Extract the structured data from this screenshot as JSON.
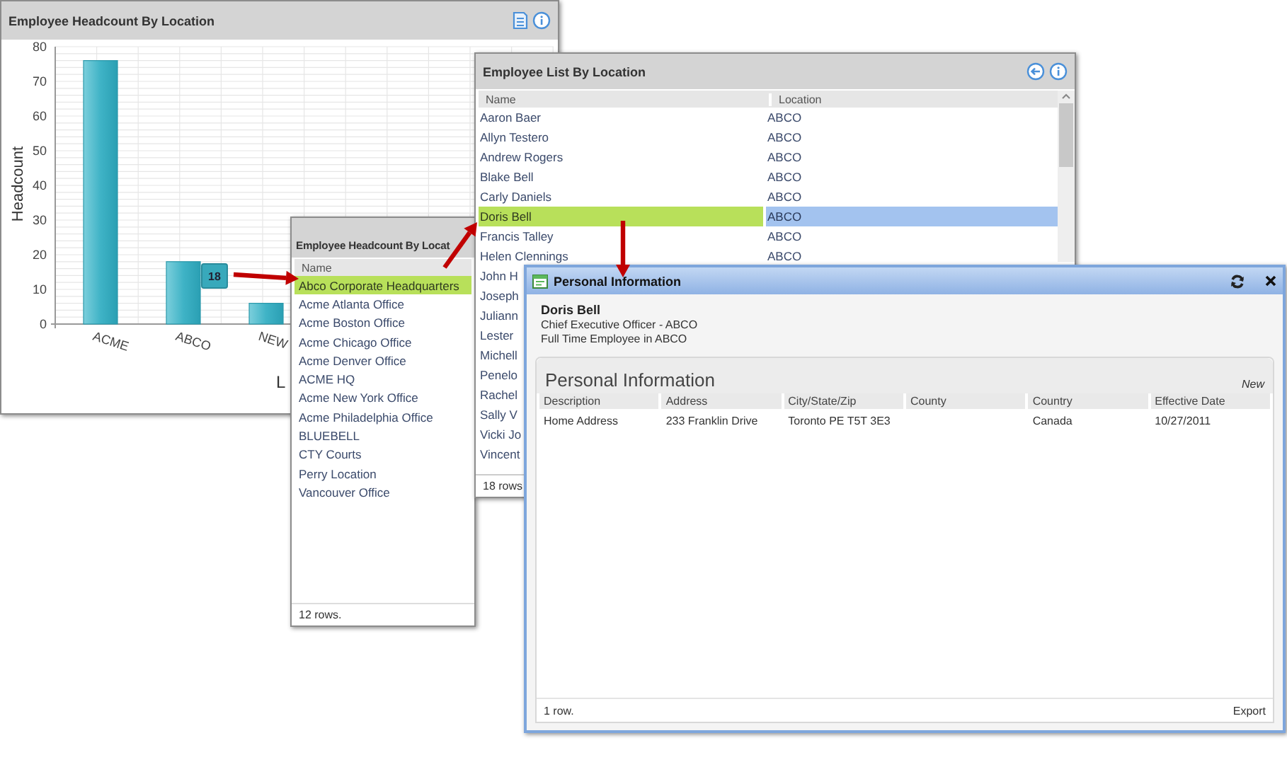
{
  "chart_window": {
    "title": "Employee Headcount By Location",
    "tooltip": "18",
    "chart_data": {
      "type": "bar",
      "grid": true,
      "ylabel": "Headcount",
      "xlabel": "L",
      "categories": [
        "ACME",
        "ABCO",
        "NEW"
      ],
      "values": [
        76,
        18,
        6
      ],
      "ylim": [
        0,
        80
      ],
      "yticks": [
        0,
        10,
        20,
        30,
        40,
        50,
        60,
        70,
        80
      ]
    }
  },
  "location_window": {
    "title": "Employee Headcount By Locat",
    "columns": [
      "Name"
    ],
    "rows": [
      {
        "name": "Abco Corporate Headquarters",
        "selected": true
      },
      {
        "name": "Acme Atlanta Office",
        "selected": false
      },
      {
        "name": "Acme Boston Office",
        "selected": false
      },
      {
        "name": "Acme Chicago Office",
        "selected": false
      },
      {
        "name": "Acme Denver Office",
        "selected": false
      },
      {
        "name": "ACME HQ",
        "selected": false
      },
      {
        "name": "Acme New York Office",
        "selected": false
      },
      {
        "name": "Acme Philadelphia Office",
        "selected": false
      },
      {
        "name": "BLUEBELL",
        "selected": false
      },
      {
        "name": "CTY Courts",
        "selected": false
      },
      {
        "name": "Perry Location",
        "selected": false
      },
      {
        "name": "Vancouver Office",
        "selected": false
      }
    ],
    "footer": "12 rows."
  },
  "employee_window": {
    "title": "Employee List By Location",
    "columns": [
      "Name",
      "Location"
    ],
    "rows": [
      {
        "name": "Aaron Baer",
        "location": "ABCO",
        "selected": false
      },
      {
        "name": "Allyn Testero",
        "location": "ABCO",
        "selected": false
      },
      {
        "name": "Andrew Rogers",
        "location": "ABCO",
        "selected": false
      },
      {
        "name": "Blake Bell",
        "location": "ABCO",
        "selected": false
      },
      {
        "name": "Carly Daniels",
        "location": "ABCO",
        "selected": false
      },
      {
        "name": "Doris Bell",
        "location": "ABCO",
        "selected": true
      },
      {
        "name": "Francis Talley",
        "location": "ABCO",
        "selected": false
      },
      {
        "name": "Helen Clennings",
        "location": "ABCO",
        "selected": false
      },
      {
        "name": "John H",
        "selected": false
      },
      {
        "name": "Joseph",
        "selected": false
      },
      {
        "name": "Juliann",
        "selected": false
      },
      {
        "name": "Lester",
        "selected": false
      },
      {
        "name": "Michell",
        "selected": false
      },
      {
        "name": "Penelo",
        "selected": false
      },
      {
        "name": "Rachel",
        "selected": false
      },
      {
        "name": "Sally V",
        "selected": false
      },
      {
        "name": "Vicki Jo",
        "selected": false
      },
      {
        "name": "Vincent",
        "selected": false
      }
    ],
    "footer": "18 rows"
  },
  "personal_window": {
    "title": "Personal Information",
    "employee": {
      "name": "Doris Bell",
      "lines": [
        "Chief Executive Officer - ABCO",
        "Full Time Employee in ABCO"
      ]
    },
    "section": {
      "title": "Personal Information",
      "action": "New",
      "columns": [
        "Description",
        "Address",
        "City/State/Zip",
        "County",
        "Country",
        "Effective Date"
      ],
      "rows": [
        {
          "cells": [
            "Home Address",
            "233 Franklin Drive",
            "Toronto PE T5T 3E3",
            null,
            "Canada",
            "10/27/2011"
          ]
        }
      ],
      "footer": "1 row.",
      "export": "Export"
    }
  }
}
